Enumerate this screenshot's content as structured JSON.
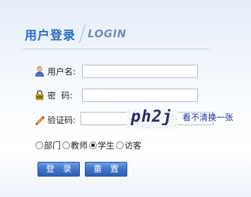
{
  "header": {
    "title_zh": "用户登录",
    "title_en": "LOGIN"
  },
  "form": {
    "username": {
      "label": "用户名:",
      "icon": "user-icon",
      "value": ""
    },
    "password": {
      "label": "密  码:",
      "icon": "lock-icon",
      "value": ""
    },
    "captcha": {
      "label": "验证码:",
      "icon": "pencil-icon",
      "value": "",
      "image_text": "ph2j",
      "refresh_link": "看不清换一张"
    }
  },
  "roles": {
    "options": [
      "部门",
      "教师",
      "学生",
      "访客"
    ],
    "selected": "学生"
  },
  "buttons": {
    "login": "登 录",
    "reset": "重 置"
  },
  "colors": {
    "title": "#2a6cc2",
    "button": "#3f74c6",
    "link": "#1f2fa8"
  }
}
